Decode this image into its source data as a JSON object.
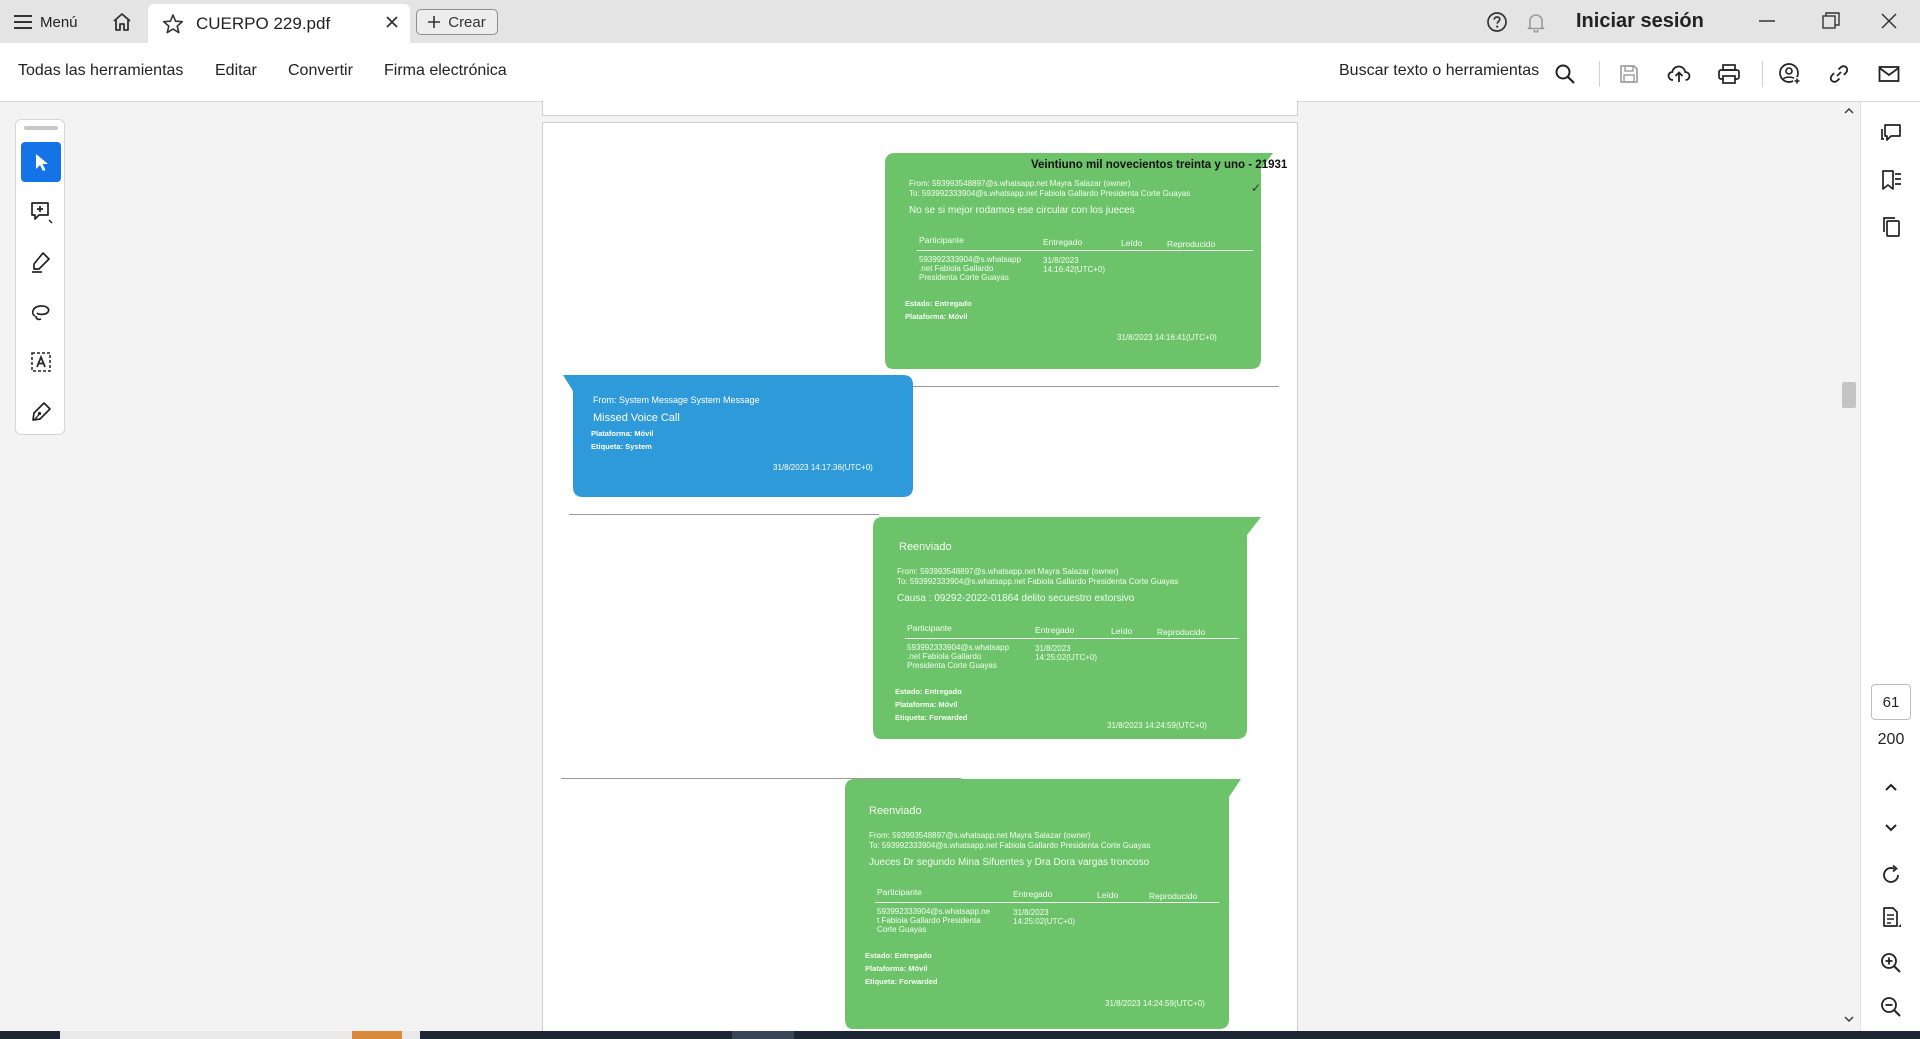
{
  "tabbar": {
    "menu_label": "Menú",
    "tab_title": "CUERPO 229.pdf",
    "create_label": "Crear",
    "signin_label": "Iniciar sesión"
  },
  "toolbar": {
    "all_tools": "Todas las herramientas",
    "edit": "Editar",
    "convert": "Convertir",
    "esign": "Firma electrónica",
    "search_label": "Buscar texto o herramientas"
  },
  "document": {
    "messages": [
      {
        "kind": "outgoing",
        "header_title": "Veintiuno mil novecientos treinta y uno - 21931",
        "from": "From: 593993548897@s.whatsapp.net Mayra Salazar (owner)",
        "to": "To: 593992333904@s.whatsapp.net Fabiola Gallardo Presidenta Corte Guayas",
        "body": "No se si mejor rodamos ese circular con los jueces",
        "table_headers": [
          "Participante",
          "Entregado",
          "Leído",
          "Reproducido"
        ],
        "participant_lines": [
          "593992333904@s.whatsapp",
          ".net Fabiola Gallardo",
          "Presidenta Corte Guayas"
        ],
        "delivered_lines": [
          "31/8/2023",
          "14:16:42(UTC+0)"
        ],
        "status": "Estado: Entregado",
        "platform": "Plataforma: Móvil",
        "timestamp": "31/8/2023 14:16:41(UTC+0)"
      },
      {
        "kind": "system",
        "from": "From: System Message System Message",
        "body": "Missed Voice Call",
        "platform": "Plataforma: Móvil",
        "label": "Etiqueta: System",
        "timestamp": "31/8/2023 14:17:36(UTC+0)"
      },
      {
        "kind": "forwarded",
        "forwarded": "Reenviado",
        "from": "From: 593993548897@s.whatsapp.net Mayra Salazar (owner)",
        "to": "To: 593992333904@s.whatsapp.net Fabiola Gallardo Presidenta Corte Guayas",
        "body": "Causa : 09292-2022-01864 delito secuestro extorsivo",
        "table_headers": [
          "Participante",
          "Entregado",
          "Leído",
          "Reproducido"
        ],
        "participant_lines": [
          "593992333904@s.whatsapp",
          ".net Fabiola Gallardo",
          "Presidenta Corte Guayas"
        ],
        "delivered_lines": [
          "31/8/2023",
          "14:25:02(UTC+0)"
        ],
        "status": "Estado: Entregado",
        "platform": "Plataforma: Móvil",
        "label": "Etiqueta: Forwarded",
        "timestamp": "31/8/2023 14:24:59(UTC+0)"
      },
      {
        "kind": "forwarded",
        "forwarded": "Reenviado",
        "from": "From: 593993548897@s.whatsapp.net Mayra Salazar (owner)",
        "to": "To: 593992333904@s.whatsapp.net Fabiola Gallardo Presidenta Corte Guayas",
        "body": "Jueces Dr segundo Mina Sifuentes y Dra Dora vargas troncoso",
        "table_headers": [
          "Participante",
          "Entregado",
          "Leído",
          "Reproducido"
        ],
        "participant_lines": [
          "593992333904@s.whatsapp.ne",
          "t Fabiola Gallardo Presidenta",
          "Corte Guayas"
        ],
        "delivered_lines": [
          "31/8/2023",
          "14:25:02(UTC+0)"
        ],
        "status": "Estado: Entregado",
        "platform": "Plataforma: Móvil",
        "label": "Etiqueta: Forwarded",
        "timestamp": "31/8/2023 14:24:59(UTC+0)"
      }
    ]
  },
  "pager": {
    "current_page": "61",
    "total_pages": "200"
  },
  "colors": {
    "accent": "#1473e6",
    "bubble_green": "#6cc36a",
    "bubble_blue": "#2f9ad9"
  }
}
